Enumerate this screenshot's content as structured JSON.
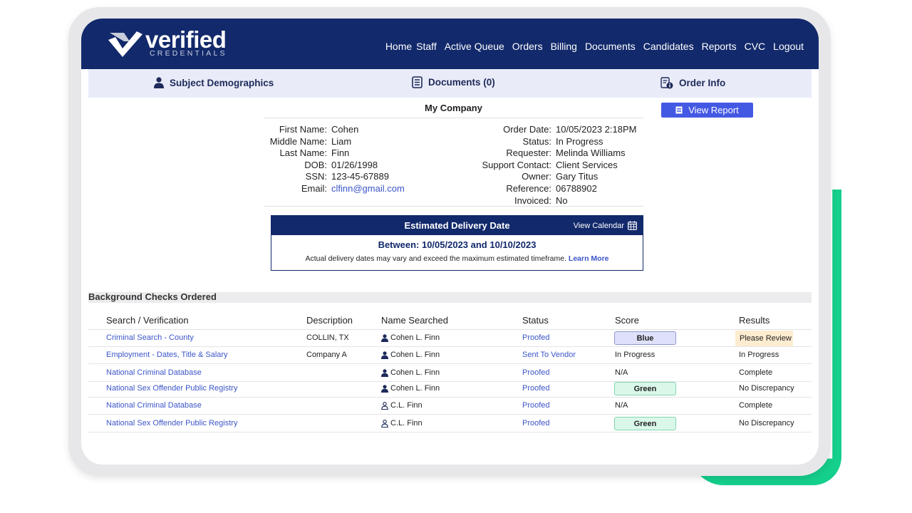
{
  "brand": {
    "name": "verified",
    "tagline": "CREDENTIALS"
  },
  "nav": [
    "Home",
    "Staff",
    "Active Queue",
    "Orders",
    "Billing",
    "Documents",
    "Candidates",
    "Reports",
    "CVC",
    "Logout"
  ],
  "tabs": {
    "demographics": "Subject Demographics",
    "documents": "Documents (0)",
    "order_info": "Order Info"
  },
  "company": "My Company",
  "subject": [
    {
      "key": "First Name:",
      "value": "Cohen"
    },
    {
      "key": "Middle Name:",
      "value": "Liam"
    },
    {
      "key": "Last Name:",
      "value": "Finn"
    },
    {
      "key": "DOB:",
      "value": "01/26/1998"
    },
    {
      "key": "SSN:",
      "value": "123-45-67889"
    },
    {
      "key": "Email:",
      "value": "clfinn@gmail.com"
    }
  ],
  "order": [
    {
      "key": "Order Date:",
      "value": "10/05/2023  2:18PM"
    },
    {
      "key": "Status:",
      "value": "In Progress"
    },
    {
      "key": "Requester:",
      "value": "Melinda Williams"
    },
    {
      "key": "Support Contact:",
      "value": "Client Services"
    },
    {
      "key": "Owner:",
      "value": "Gary Titus"
    },
    {
      "key": "Reference:",
      "value": "06788902"
    },
    {
      "key": "Invoiced:",
      "value": "No"
    }
  ],
  "view_report": "View Report",
  "delivery": {
    "title": "Estimated Delivery Date",
    "calendar": "View Calendar",
    "range": "Between: 10/05/2023 and 10/10/2023",
    "note": "Actual delivery dates may vary and exceed the maximum estimated timeframe.",
    "learn_more": "Learn More"
  },
  "checks": {
    "title": "Background Checks Ordered",
    "columns": [
      "Search / Verification",
      "Description",
      "Name Searched",
      "Status",
      "Score",
      "Results"
    ],
    "rows": [
      {
        "search": "Criminal Search - County",
        "description": "COLLIN, TX",
        "name": "Cohen L. Finn",
        "person": "filled",
        "status": "Proofed",
        "score": "Blue",
        "score_style": "blue",
        "result": "Please Review",
        "result_style": "review"
      },
      {
        "search": "Employment - Dates, Title & Salary",
        "description": "Company A",
        "name": "Cohen L. Finn",
        "person": "filled",
        "status": "Sent To Vendor",
        "score": "In Progress",
        "score_style": "text",
        "result": "In Progress",
        "result_style": "text"
      },
      {
        "search": "National Criminal Database",
        "description": "",
        "name": "Cohen L. Finn",
        "person": "filled",
        "status": "Proofed",
        "score": "N/A",
        "score_style": "text",
        "result": "Complete",
        "result_style": "text"
      },
      {
        "search": "National Sex Offender Public Registry",
        "description": "",
        "name": "Cohen L. Finn",
        "person": "filled",
        "status": "Proofed",
        "score": "Green",
        "score_style": "green",
        "result": "No Discrepancy",
        "result_style": "text"
      },
      {
        "search": "National Criminal Database",
        "description": "",
        "name": "C.L. Finn",
        "person": "outline",
        "status": "Proofed",
        "score": "N/A",
        "score_style": "text",
        "result": "Complete",
        "result_style": "text"
      },
      {
        "search": "National Sex Offender Public Registry",
        "description": "",
        "name": "C.L. Finn",
        "person": "outline",
        "status": "Proofed",
        "score": "Green",
        "score_style": "green",
        "result": "No Discrepancy",
        "result_style": "text"
      }
    ]
  },
  "colors": {
    "navy": "#12296b",
    "accent_green": "#15cf8c",
    "link": "#3b55c8",
    "button": "#4459e3"
  },
  "icons": {
    "logo": "check-logo-icon",
    "person": "person-icon",
    "documents": "document-icon",
    "order_info": "order-info-icon",
    "report": "report-icon",
    "calendar": "calendar-icon"
  }
}
